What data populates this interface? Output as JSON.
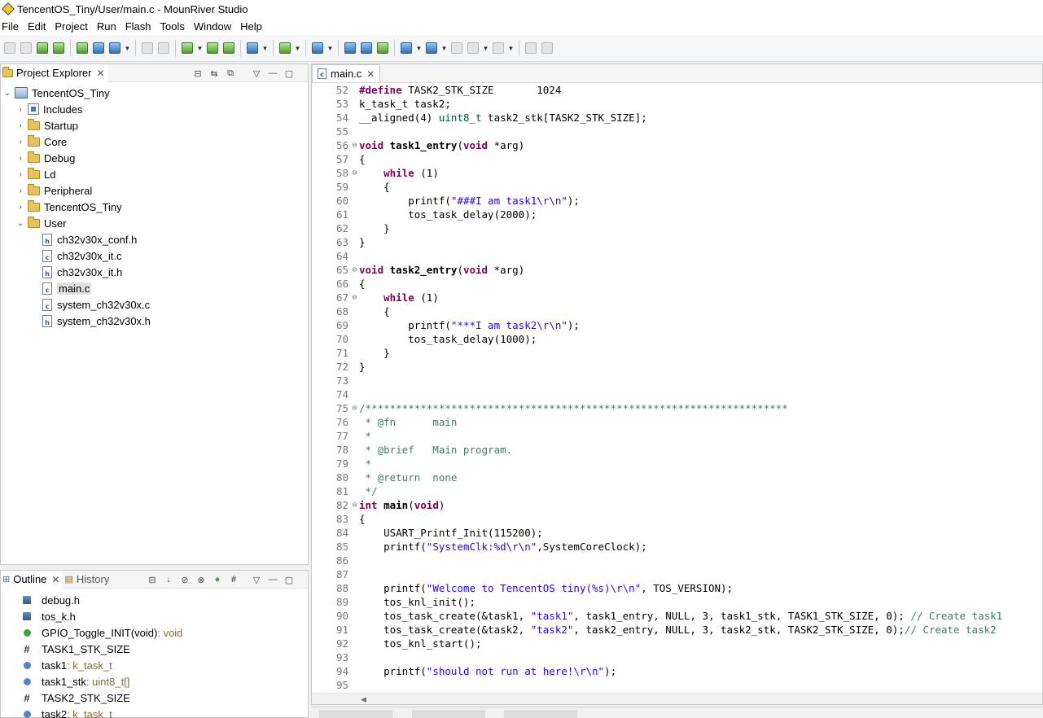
{
  "window": {
    "title": "TencentOS_Tiny/User/main.c - MounRiver Studio"
  },
  "menu": [
    "File",
    "Edit",
    "Project",
    "Run",
    "Flash",
    "Tools",
    "Window",
    "Help"
  ],
  "project_explorer": {
    "title": "Project Explorer",
    "project": "TencentOS_Tiny",
    "folders": [
      "Includes",
      "Startup",
      "Core",
      "Debug",
      "Ld",
      "Peripheral",
      "TencentOS_Tiny",
      "User"
    ],
    "user_files": [
      {
        "name": "ch32v30x_conf.h",
        "ext": "h"
      },
      {
        "name": "ch32v30x_it.c",
        "ext": "c"
      },
      {
        "name": "ch32v30x_it.h",
        "ext": "h"
      },
      {
        "name": "main.c",
        "ext": "c",
        "selected": true
      },
      {
        "name": "system_ch32v30x.c",
        "ext": "c"
      },
      {
        "name": "system_ch32v30x.h",
        "ext": "h"
      }
    ]
  },
  "outline": {
    "title": "Outline",
    "history_title": "History",
    "items": [
      {
        "kind": "include",
        "name": "debug.h",
        "type": ""
      },
      {
        "kind": "include",
        "name": "tos_k.h",
        "type": ""
      },
      {
        "kind": "func",
        "name": "GPIO_Toggle_INIT(void)",
        "type": " : void"
      },
      {
        "kind": "macro",
        "name": "TASK1_STK_SIZE",
        "type": ""
      },
      {
        "kind": "var",
        "name": "task1",
        "type": " : k_task_t"
      },
      {
        "kind": "var",
        "name": "task1_stk",
        "type": " : uint8_t[]"
      },
      {
        "kind": "macro",
        "name": "TASK2_STK_SIZE",
        "type": ""
      },
      {
        "kind": "var",
        "name": "task2",
        "type": " : k_task_t"
      }
    ]
  },
  "editor": {
    "tab": "main.c",
    "lines": [
      {
        "n": "52",
        "fold": "",
        "src": "#define TASK2_STK_SIZE       1024"
      },
      {
        "n": "53",
        "fold": "",
        "src": "k_task_t task2;"
      },
      {
        "n": "54",
        "fold": "",
        "src": "__aligned(4) uint8_t task2_stk[TASK2_STK_SIZE];"
      },
      {
        "n": "55",
        "fold": "",
        "src": ""
      },
      {
        "n": "56",
        "fold": "⊖",
        "src": "void task1_entry(void *arg)"
      },
      {
        "n": "57",
        "fold": "",
        "src": "{"
      },
      {
        "n": "58",
        "fold": "⊖",
        "src": "    while (1)"
      },
      {
        "n": "59",
        "fold": "",
        "src": "    {"
      },
      {
        "n": "60",
        "fold": "",
        "src": "        printf(\"###I am task1\\r\\n\");"
      },
      {
        "n": "61",
        "fold": "",
        "src": "        tos_task_delay(2000);"
      },
      {
        "n": "62",
        "fold": "",
        "src": "    }"
      },
      {
        "n": "63",
        "fold": "",
        "src": "}"
      },
      {
        "n": "64",
        "fold": "",
        "src": ""
      },
      {
        "n": "65",
        "fold": "⊖",
        "src": "void task2_entry(void *arg)"
      },
      {
        "n": "66",
        "fold": "",
        "src": "{"
      },
      {
        "n": "67",
        "fold": "⊖",
        "src": "    while (1)"
      },
      {
        "n": "68",
        "fold": "",
        "src": "    {"
      },
      {
        "n": "69",
        "fold": "",
        "src": "        printf(\"***I am task2\\r\\n\");"
      },
      {
        "n": "70",
        "fold": "",
        "src": "        tos_task_delay(1000);"
      },
      {
        "n": "71",
        "fold": "",
        "src": "    }"
      },
      {
        "n": "72",
        "fold": "",
        "src": "}"
      },
      {
        "n": "73",
        "fold": "",
        "src": ""
      },
      {
        "n": "74",
        "fold": "",
        "src": ""
      },
      {
        "n": "75",
        "fold": "⊖",
        "src": "/*********************************************************************"
      },
      {
        "n": "76",
        "fold": "",
        "src": " * @fn      main"
      },
      {
        "n": "77",
        "fold": "",
        "src": " *"
      },
      {
        "n": "78",
        "fold": "",
        "src": " * @brief   Main program."
      },
      {
        "n": "79",
        "fold": "",
        "src": " *"
      },
      {
        "n": "80",
        "fold": "",
        "src": " * @return  none"
      },
      {
        "n": "81",
        "fold": "",
        "src": " */"
      },
      {
        "n": "82",
        "fold": "⊖",
        "src": "int main(void)"
      },
      {
        "n": "83",
        "fold": "",
        "src": "{"
      },
      {
        "n": "84",
        "fold": "",
        "src": "    USART_Printf_Init(115200);"
      },
      {
        "n": "85",
        "fold": "",
        "src": "    printf(\"SystemClk:%d\\r\\n\",SystemCoreClock);"
      },
      {
        "n": "86",
        "fold": "",
        "src": ""
      },
      {
        "n": "87",
        "fold": "",
        "src": ""
      },
      {
        "n": "88",
        "fold": "",
        "src": "    printf(\"Welcome to TencentOS tiny(%s)\\r\\n\", TOS_VERSION);"
      },
      {
        "n": "89",
        "fold": "",
        "src": "    tos_knl_init();"
      },
      {
        "n": "90",
        "fold": "",
        "src": "    tos_task_create(&task1, \"task1\", task1_entry, NULL, 3, task1_stk, TASK1_STK_SIZE, 0); // Create task1"
      },
      {
        "n": "91",
        "fold": "",
        "src": "    tos_task_create(&task2, \"task2\", task2_entry, NULL, 3, task2_stk, TASK2_STK_SIZE, 0);// Create task2"
      },
      {
        "n": "92",
        "fold": "",
        "src": "    tos_knl_start();"
      },
      {
        "n": "93",
        "fold": "",
        "src": ""
      },
      {
        "n": "94",
        "fold": "",
        "src": "    printf(\"should not run at here!\\r\\n\");"
      },
      {
        "n": "95",
        "fold": "",
        "src": ""
      }
    ]
  }
}
